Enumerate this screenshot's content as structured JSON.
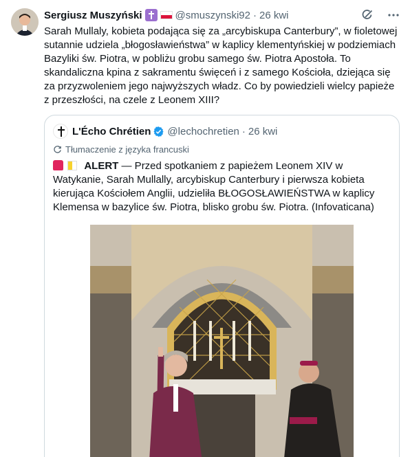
{
  "tweet": {
    "author_name": "Sergiusz Muszyński",
    "handle": "@smuszynski92",
    "separator": "·",
    "time": "26 kwi",
    "more_label": "···",
    "text": "Sarah Mullaly, kobieta podająca się za „arcybiskupa Canterbury”, w fioletowej sutannie udziela „błogosławieństwa” w kaplicy klementyńskiej w podziemiach Bazyliki św. Piotra, w pobliżu grobu samego św. Piotra Apostoła. To skandaliczna kpina z sakramentu święceń i z samego Kościoła, dziejąca się za przyzwoleniem jego najwyższych władz. Co by powiedzieli wielcy papieże z przeszłości, na czele z Leonem XIII?"
  },
  "quote": {
    "author_name": "L'Écho Chrétien",
    "handle": "@lechochretien",
    "separator": "·",
    "time": "26 kwi",
    "translation_label": "Tłumaczenie z języka francuski",
    "alert_label": "ALERT",
    "text": " — Przed spotkaniem z papieżem Leonem XIV w Watykanie, Sarah Mullally, arcybiskup Canterbury i pierwsza kobieta kierująca Kościołem Anglii, udzieliła BŁOGOSŁAWIEŃSTWA w kaplicy Klemensa w bazylice św. Piotra, blisko grobu św. Piotra. (Infovaticana)"
  },
  "colors": {
    "accent": "#1d9bf0",
    "text": "#0f1419",
    "secondary": "#536471",
    "border": "#cfd9de",
    "purple_robe": "#7a2a4a"
  },
  "icons": {
    "author_badge": "cross-badge-icon",
    "author_flag": "poland-flag-icon",
    "grok": "grok-icon",
    "more": "more-icon",
    "verified": "verified-icon",
    "translate": "translate-icon",
    "siren": "siren-emoji-icon",
    "vatican_flag": "vatican-flag-icon"
  }
}
